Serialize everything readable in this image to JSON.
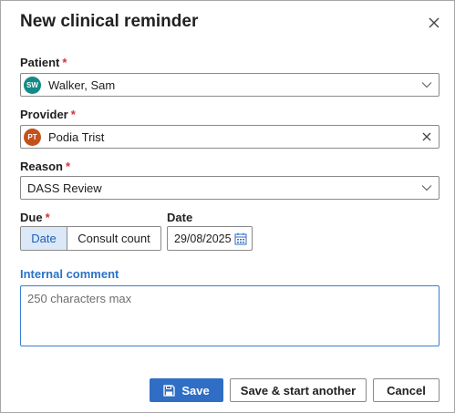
{
  "dialog": {
    "title": "New clinical reminder"
  },
  "patient": {
    "label": "Patient",
    "required_mark": "*",
    "initials": "SW",
    "avatar_color": "#138a85",
    "name": "Walker, Sam"
  },
  "provider": {
    "label": "Provider",
    "required_mark": "*",
    "initials": "PT",
    "avatar_color": "#c4511c",
    "name": "Podia Trist"
  },
  "reason": {
    "label": "Reason",
    "required_mark": "*",
    "value": "DASS Review"
  },
  "due": {
    "label": "Due",
    "required_mark": "*",
    "options": [
      "Date",
      "Consult count"
    ],
    "selected": "Date"
  },
  "date": {
    "label": "Date",
    "value": "29/08/2025"
  },
  "comment": {
    "label": "Internal comment",
    "placeholder": "250 characters max",
    "value": ""
  },
  "actions": {
    "save_label": "Save",
    "save_another_label": "Save & start another",
    "cancel_label": "Cancel"
  },
  "colors": {
    "primary": "#2f6ec4",
    "required": "#d13438",
    "link_label": "#2a73c7",
    "segment_active_bg": "#dbe8f8"
  }
}
